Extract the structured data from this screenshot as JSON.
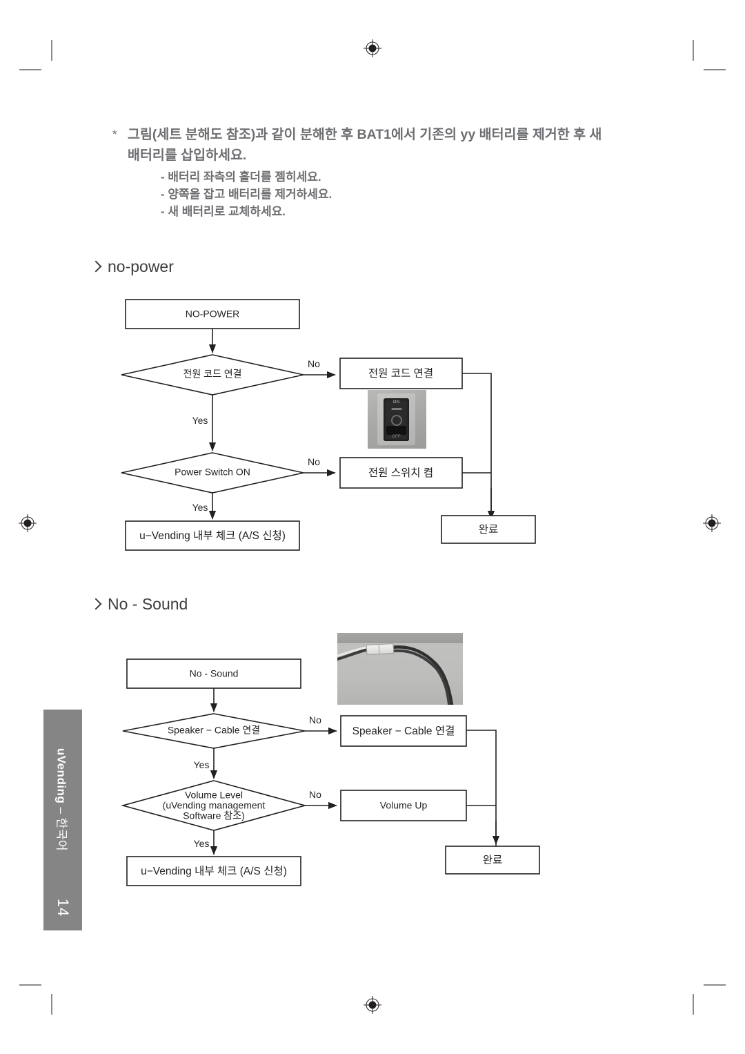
{
  "page": {
    "number": "14",
    "sidebar_brand": "uVending",
    "sidebar_separator": "–",
    "sidebar_language": "한국어"
  },
  "note": {
    "bullet": "*",
    "main_line_1": "그림(세트 분해도 참조)과 같이 분해한 후 BAT1에서 기존의 yy 배터리를 제거한 후 새",
    "main_line_2": "배터리를 삽입하세요.",
    "sub_items": [
      "- 배터리 좌측의 홀더를 젬히세요.",
      "- 양쪽을 잡고 배터리를 제거하세요.",
      "- 새 배터리로 교체하세요."
    ]
  },
  "sections": [
    {
      "id": "no-power",
      "heading": "no-power"
    },
    {
      "id": "no-sound",
      "heading": "No - Sound"
    }
  ],
  "chart_data": [
    {
      "type": "diagram",
      "title": "no-power",
      "nodes": [
        {
          "id": "np-start",
          "shape": "box",
          "label": "NO-POWER"
        },
        {
          "id": "np-d1",
          "shape": "diamond",
          "label": "전원 코드 연결"
        },
        {
          "id": "np-a1",
          "shape": "box",
          "label": "전원 코드 연결"
        },
        {
          "id": "np-d2",
          "shape": "diamond",
          "label": "Power Switch ON"
        },
        {
          "id": "np-a2",
          "shape": "box",
          "label": "전원 스위치 켬"
        },
        {
          "id": "np-end-yes",
          "shape": "box",
          "label": "u−Vending 내부 체크 (A/S 신청)"
        },
        {
          "id": "np-end-no",
          "shape": "box",
          "label": "완료"
        }
      ],
      "edges": [
        {
          "from": "np-start",
          "to": "np-d1",
          "label": ""
        },
        {
          "from": "np-d1",
          "to": "np-a1",
          "label": "No"
        },
        {
          "from": "np-d1",
          "to": "np-d2",
          "label": "Yes"
        },
        {
          "from": "np-d2",
          "to": "np-a2",
          "label": "No"
        },
        {
          "from": "np-d2",
          "to": "np-end-yes",
          "label": "Yes"
        },
        {
          "from": "np-a1",
          "to": "np-end-no",
          "label": ""
        },
        {
          "from": "np-a2",
          "to": "np-end-no",
          "label": ""
        }
      ],
      "images": [
        {
          "id": "power-switch-photo",
          "caption": ""
        }
      ]
    },
    {
      "type": "diagram",
      "title": "No - Sound",
      "nodes": [
        {
          "id": "ns-start",
          "shape": "box",
          "label": "No - Sound"
        },
        {
          "id": "ns-d1",
          "shape": "diamond",
          "label": "Speaker − Cable 연결"
        },
        {
          "id": "ns-a1",
          "shape": "box",
          "label": "Speaker − Cable 연결"
        },
        {
          "id": "ns-d2",
          "shape": "diamond",
          "label_line_1": "Volume Level",
          "label_line_2": "(uVending management",
          "label_line_3": "Software 참조)"
        },
        {
          "id": "ns-a2",
          "shape": "box",
          "label": "Volume Up"
        },
        {
          "id": "ns-end-yes",
          "shape": "box",
          "label": "u−Vending 내부 체크 (A/S 신청)"
        },
        {
          "id": "ns-end-no",
          "shape": "box",
          "label": "완료"
        }
      ],
      "edges": [
        {
          "from": "ns-start",
          "to": "ns-d1",
          "label": ""
        },
        {
          "from": "ns-d1",
          "to": "ns-a1",
          "label": "No"
        },
        {
          "from": "ns-d1",
          "to": "ns-d2",
          "label": "Yes"
        },
        {
          "from": "ns-d2",
          "to": "ns-a2",
          "label": "No"
        },
        {
          "from": "ns-d2",
          "to": "ns-end-yes",
          "label": "Yes"
        },
        {
          "from": "ns-a1",
          "to": "ns-end-no",
          "label": ""
        },
        {
          "from": "ns-a2",
          "to": "ns-end-no",
          "label": ""
        }
      ],
      "images": [
        {
          "id": "speaker-cable-photo",
          "caption": ""
        }
      ]
    }
  ],
  "photos": {
    "power_switch": {
      "on_label": "ON",
      "off_label": "OFF"
    }
  }
}
